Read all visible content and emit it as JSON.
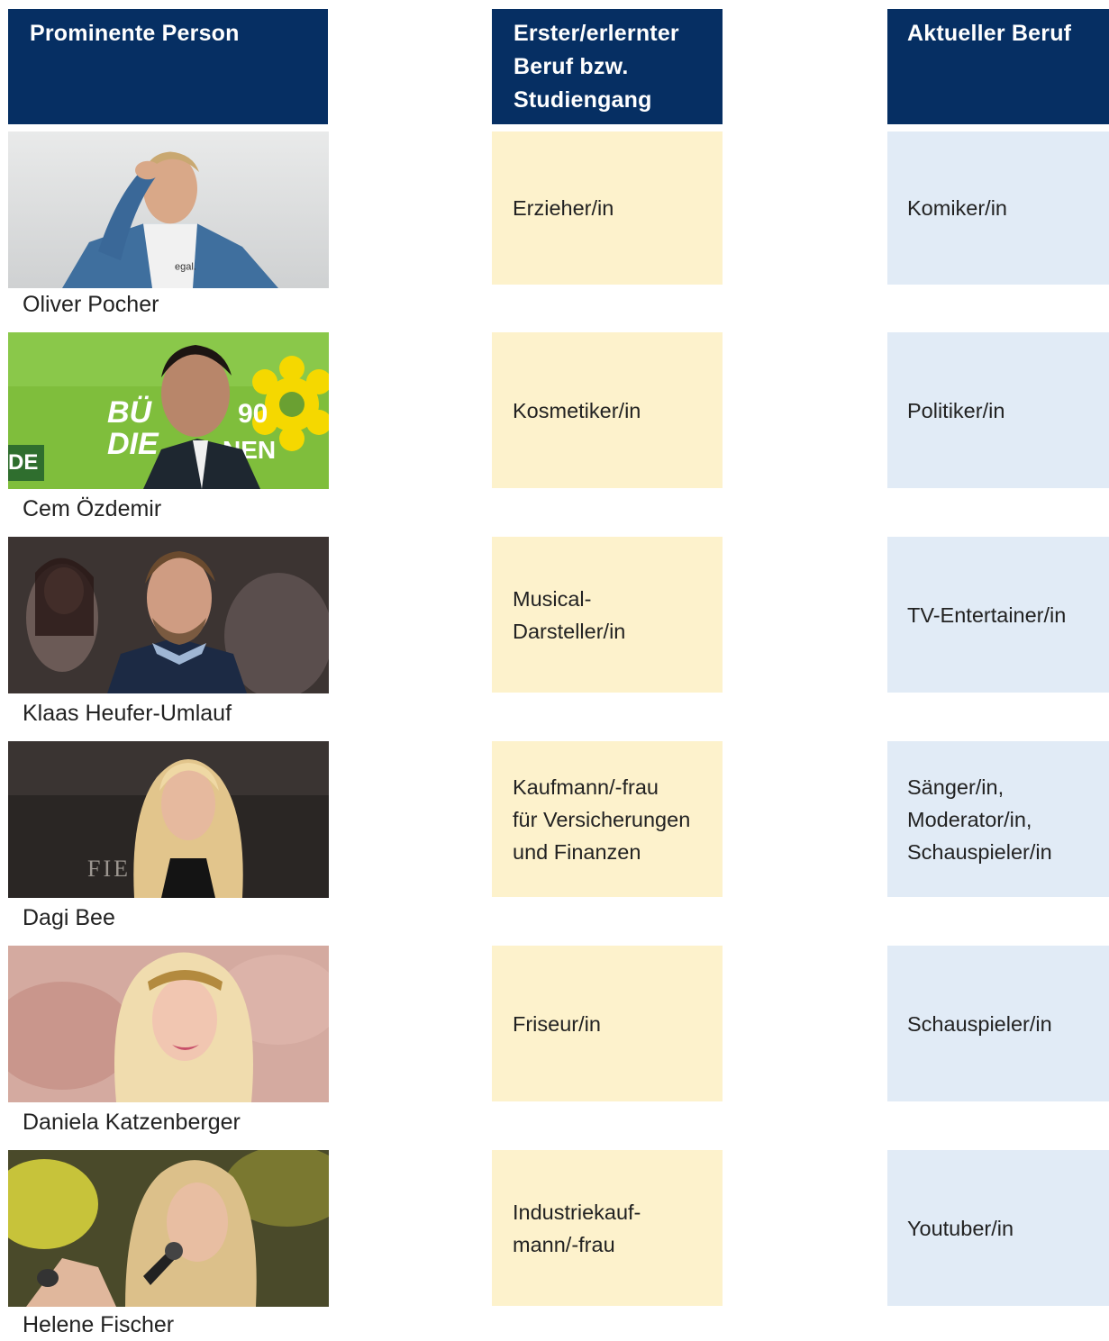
{
  "headers": {
    "person": "Prominente Person",
    "first_job": "Erster/erlernter\nBeruf bzw.\nStudiengang",
    "current_job": "Aktueller Beruf"
  },
  "rows": [
    {
      "name": "Oliver Pocher",
      "first_job": "Erzieher/in",
      "current_job": "Komiker/in"
    },
    {
      "name": "Cem Özdemir",
      "first_job": "Kosmetiker/in",
      "current_job": "Politiker/in"
    },
    {
      "name": "Klaas Heufer-Umlauf",
      "first_job": "Musical-\nDarsteller/in",
      "current_job": "TV-Entertainer/in"
    },
    {
      "name": "Dagi Bee",
      "first_job": "Kaufmann/-frau\nfür Versicherungen\nund Finanzen",
      "current_job": "Sänger/in,\nModerator/in,\nSchauspieler/in"
    },
    {
      "name": "Daniela Katzenberger",
      "first_job": "Friseur/in",
      "current_job": "Schauspieler/in"
    },
    {
      "name": "Helene Fischer",
      "first_job": "Industriekauf-\nmann/-frau",
      "current_job": "Youtuber/in"
    }
  ],
  "photo_details": {
    "shirt_print": "egal.",
    "banner_party": "BÜ",
    "banner_party2": "DIE",
    "banner_party3": "NEN",
    "banner_number": "90",
    "banner_left": "DE",
    "backdrop_text": "FIE"
  },
  "colors": {
    "header_bg": "#062f63",
    "first_job_bg": "#fdf2cc",
    "current_job_bg": "#e1ebf6"
  }
}
